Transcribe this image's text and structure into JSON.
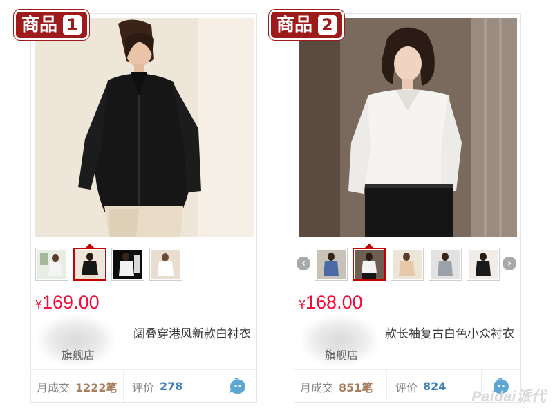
{
  "products": [
    {
      "badge_label": "商品",
      "badge_number": "1",
      "currency": "¥",
      "price": "169.00",
      "title": "阔叠穿港风新款白衬衣",
      "shop": "旗舰店",
      "sales_label": "月成交",
      "sales": "1222笔",
      "reviews_label": "评价",
      "reviews": "278",
      "thumbnail_count": 4,
      "selected_thumbnail": 2,
      "has_nav_arrows": false
    },
    {
      "badge_label": "商品",
      "badge_number": "2",
      "currency": "¥",
      "price": "168.00",
      "title": "款长袖复古白色小众衬衣",
      "shop": "旗舰店",
      "sales_label": "月成交",
      "sales": "851笔",
      "reviews_label": "评价",
      "reviews": "824",
      "thumbnail_count": 5,
      "selected_thumbnail": 2,
      "has_nav_arrows": true
    }
  ],
  "nav": {
    "prev_icon": "‹",
    "next_icon": "›"
  },
  "watermark": "Paidai派代",
  "colors": {
    "badge": "#9e1b1b",
    "price": "#f40b3a",
    "selected_border": "#c40000",
    "sales_number": "#a87d5b",
    "review_number": "#3d7fb5",
    "chat_icon": "#5aa7d6"
  },
  "icons": {
    "chat": "chat-bubble-icon"
  }
}
